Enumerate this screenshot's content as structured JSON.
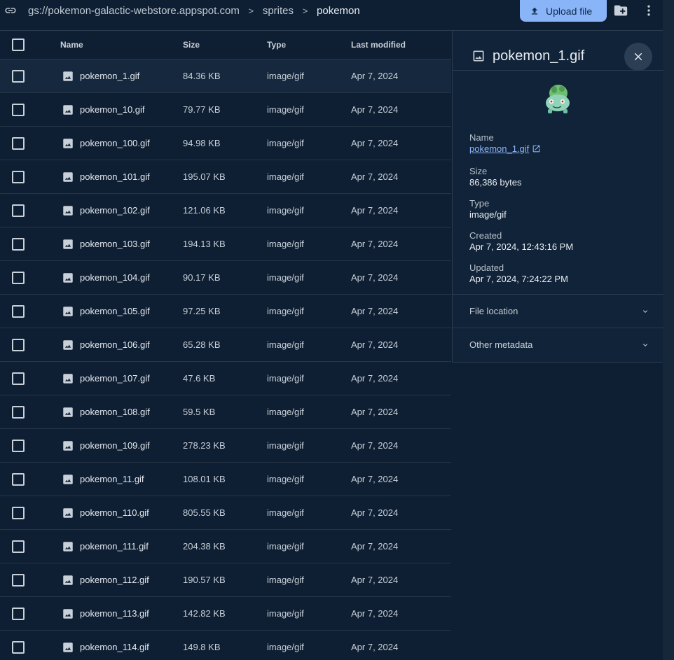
{
  "breadcrumb": {
    "bucket": "gs://pokemon-galactic-webstore.appspot.com",
    "folder": "sprites",
    "current": "pokemon",
    "separator": ">"
  },
  "toolbar": {
    "upload_label": "Upload file",
    "upload_icon": "upload-icon",
    "new_folder_icon": "new-folder-icon",
    "more_icon": "more-vert-icon"
  },
  "table": {
    "headers": {
      "name": "Name",
      "size": "Size",
      "type": "Type",
      "modified": "Last modified"
    },
    "rows": [
      {
        "name": "pokemon_1.gif",
        "size": "84.36 KB",
        "type": "image/gif",
        "modified": "Apr 7, 2024"
      },
      {
        "name": "pokemon_10.gif",
        "size": "79.77 KB",
        "type": "image/gif",
        "modified": "Apr 7, 2024"
      },
      {
        "name": "pokemon_100.gif",
        "size": "94.98 KB",
        "type": "image/gif",
        "modified": "Apr 7, 2024"
      },
      {
        "name": "pokemon_101.gif",
        "size": "195.07 KB",
        "type": "image/gif",
        "modified": "Apr 7, 2024"
      },
      {
        "name": "pokemon_102.gif",
        "size": "121.06 KB",
        "type": "image/gif",
        "modified": "Apr 7, 2024"
      },
      {
        "name": "pokemon_103.gif",
        "size": "194.13 KB",
        "type": "image/gif",
        "modified": "Apr 7, 2024"
      },
      {
        "name": "pokemon_104.gif",
        "size": "90.17 KB",
        "type": "image/gif",
        "modified": "Apr 7, 2024"
      },
      {
        "name": "pokemon_105.gif",
        "size": "97.25 KB",
        "type": "image/gif",
        "modified": "Apr 7, 2024"
      },
      {
        "name": "pokemon_106.gif",
        "size": "65.28 KB",
        "type": "image/gif",
        "modified": "Apr 7, 2024"
      },
      {
        "name": "pokemon_107.gif",
        "size": "47.6 KB",
        "type": "image/gif",
        "modified": "Apr 7, 2024"
      },
      {
        "name": "pokemon_108.gif",
        "size": "59.5 KB",
        "type": "image/gif",
        "modified": "Apr 7, 2024"
      },
      {
        "name": "pokemon_109.gif",
        "size": "278.23 KB",
        "type": "image/gif",
        "modified": "Apr 7, 2024"
      },
      {
        "name": "pokemon_11.gif",
        "size": "108.01 KB",
        "type": "image/gif",
        "modified": "Apr 7, 2024"
      },
      {
        "name": "pokemon_110.gif",
        "size": "805.55 KB",
        "type": "image/gif",
        "modified": "Apr 7, 2024"
      },
      {
        "name": "pokemon_111.gif",
        "size": "204.38 KB",
        "type": "image/gif",
        "modified": "Apr 7, 2024"
      },
      {
        "name": "pokemon_112.gif",
        "size": "190.57 KB",
        "type": "image/gif",
        "modified": "Apr 7, 2024"
      },
      {
        "name": "pokemon_113.gif",
        "size": "142.82 KB",
        "type": "image/gif",
        "modified": "Apr 7, 2024"
      },
      {
        "name": "pokemon_114.gif",
        "size": "149.8 KB",
        "type": "image/gif",
        "modified": "Apr 7, 2024"
      }
    ]
  },
  "details": {
    "title": "pokemon_1.gif",
    "name_label": "Name",
    "name_value": "pokemon_1.gif",
    "size_label": "Size",
    "size_value": "86,386 bytes",
    "type_label": "Type",
    "type_value": "image/gif",
    "created_label": "Created",
    "created_value": "Apr 7, 2024, 12:43:16 PM",
    "updated_label": "Updated",
    "updated_value": "Apr 7, 2024, 7:24:22 PM",
    "sections": [
      "File location",
      "Other metadata"
    ]
  },
  "colors": {
    "background": "#0f1f33",
    "accent": "#8ab4f8",
    "panel": "#112338"
  }
}
